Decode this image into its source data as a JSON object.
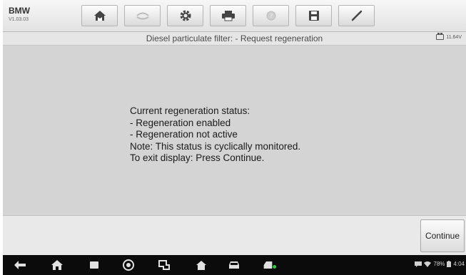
{
  "app": {
    "brand": "BMW",
    "version": "V1.03.03"
  },
  "toolbar": {
    "buttons": [
      {
        "icon": "home-icon"
      },
      {
        "icon": "vehicle-swap-icon"
      },
      {
        "icon": "settings-gear-icon"
      },
      {
        "icon": "print-icon"
      },
      {
        "icon": "help-icon"
      },
      {
        "icon": "save-icon"
      },
      {
        "icon": "data-logging-icon"
      }
    ]
  },
  "header": {
    "title": "Diesel particulate filter: - Request regeneration",
    "battery_voltage": "11.64V"
  },
  "message": {
    "lines": [
      "Current regeneration status:",
      "- Regeneration enabled",
      "- Regeneration not active",
      "Note: This status is cyclically monitored.",
      "To exit display: Press Continue."
    ]
  },
  "actions": {
    "continue_label": "Continue"
  },
  "navbar": {
    "icons": [
      "back-icon",
      "home-icon",
      "recent-apps-icon",
      "browser-icon",
      "remote-icon",
      "autel-home-icon",
      "vehicle-icon",
      "vci-icon"
    ],
    "battery_percent": "78%",
    "time": "4:04"
  }
}
